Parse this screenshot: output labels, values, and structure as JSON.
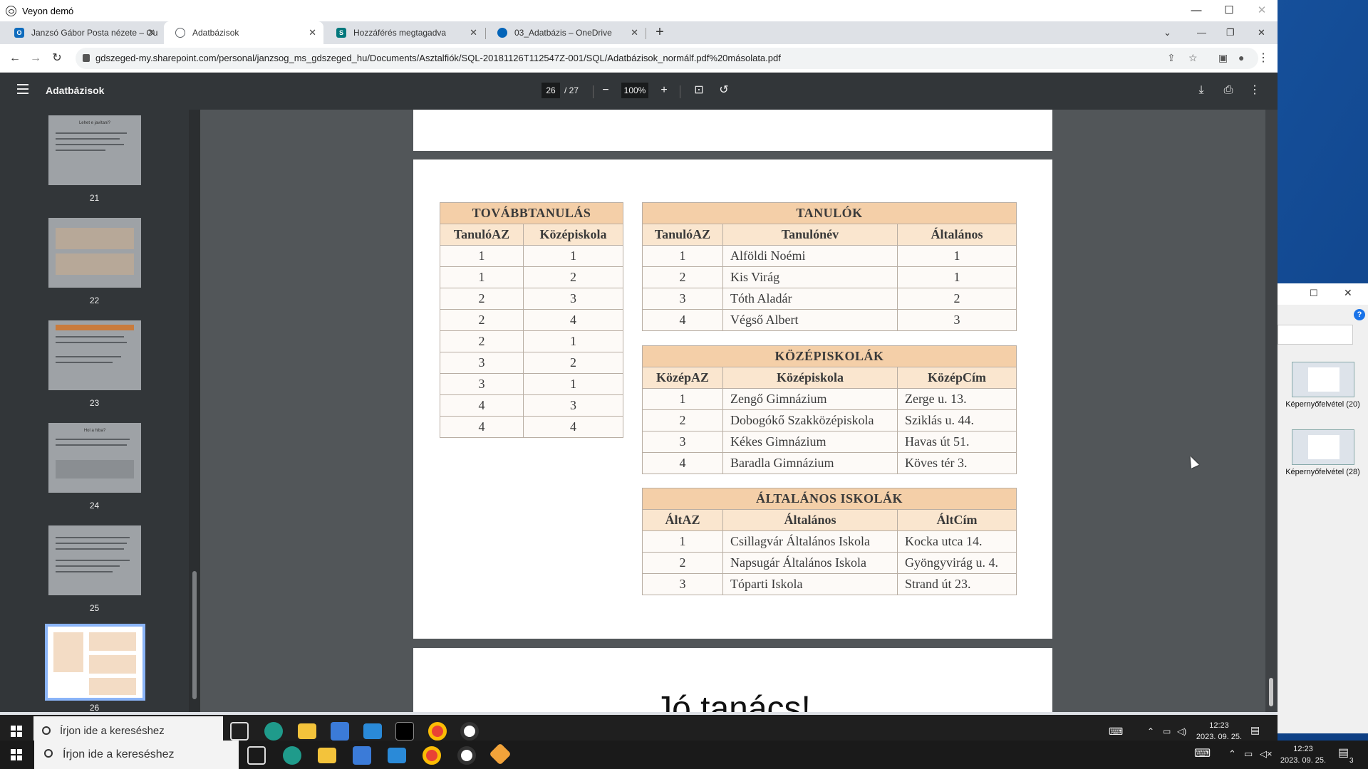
{
  "window": {
    "title": "Veyon demó"
  },
  "tabs": [
    {
      "label": "Janzsó Gábor Posta nézete – Ou",
      "icon": "outlook-icon",
      "color": "#0f6cbd",
      "glyph": "O"
    },
    {
      "label": "Adatbázisok",
      "icon": "globe-icon",
      "color": "#5f6368",
      "glyph": "◎"
    },
    {
      "label": "Hozzáférés megtagadva",
      "icon": "sharepoint-icon",
      "color": "#03787c",
      "glyph": "S"
    },
    {
      "label": "03_Adatbázis – OneDrive",
      "icon": "onedrive-icon",
      "color": "#0364b8",
      "glyph": "☁"
    }
  ],
  "url": "gdszeged-my.sharepoint.com/personal/janzsog_ms_gdszeged_hu/Documents/Asztalfiók/SQL-20181126T112547Z-001/SQL/Adatbázisok_normálf.pdf%20másolata.pdf",
  "pdf": {
    "title": "Adatbázisok",
    "page": "26",
    "page_total": "/ 27",
    "zoom": "100%"
  },
  "thumbnails": [
    "21",
    "22",
    "23",
    "24",
    "25",
    "26"
  ],
  "thumb_titles": {
    "t21": "Lehet e javítani?",
    "t24": "Hol a hiba?"
  },
  "tovabb": {
    "caption": "TOVÁBBTANULÁS",
    "headers": [
      "TanulóAZ",
      "Középiskola"
    ],
    "rows": [
      [
        "1",
        "1"
      ],
      [
        "1",
        "2"
      ],
      [
        "2",
        "3"
      ],
      [
        "2",
        "4"
      ],
      [
        "2",
        "1"
      ],
      [
        "3",
        "2"
      ],
      [
        "3",
        "1"
      ],
      [
        "4",
        "3"
      ],
      [
        "4",
        "4"
      ]
    ]
  },
  "tanulok": {
    "caption": "TANULÓK",
    "headers": [
      "TanulóAZ",
      "Tanulónév",
      "Általános"
    ],
    "rows": [
      [
        "1",
        "Alföldi Noémi",
        "1"
      ],
      [
        "2",
        "Kis Virág",
        "1"
      ],
      [
        "3",
        "Tóth Aladár",
        "2"
      ],
      [
        "4",
        "Végső Albert",
        "3"
      ]
    ]
  },
  "kozep": {
    "caption": "KÖZÉPISKOLÁK",
    "headers": [
      "KözépAZ",
      "Középiskola",
      "KözépCím"
    ],
    "rows": [
      [
        "1",
        "Zengő Gimnázium",
        "Zerge u. 13."
      ],
      [
        "2",
        "Dobogókő Szakközépiskola",
        "Sziklás u. 44."
      ],
      [
        "3",
        "Kékes Gimnázium",
        "Havas út 51."
      ],
      [
        "4",
        "Baradla Gimnázium",
        "Köves tér 3."
      ]
    ]
  },
  "altalanos": {
    "caption": "ÁLTALÁNOS ISKOLÁK",
    "headers": [
      "ÁltAZ",
      "Általános",
      "ÁltCím"
    ],
    "rows": [
      [
        "1",
        "Csillagvár Általános Iskola",
        "Kocka utca 14."
      ],
      [
        "2",
        "Napsugár Általános Iskola",
        "Gyöngyvirág u. 4."
      ],
      [
        "3",
        "Tóparti Iskola",
        "Strand út 23."
      ]
    ]
  },
  "next_page_title": "Jó tanács!",
  "taskbar": {
    "search_placeholder": "Írjon ide a kereséshez",
    "time": "12:23",
    "date": "2023. 09. 25.",
    "notif_count": "3"
  },
  "right_files": [
    "Képernyőfelvétel (20)",
    "Képernyőfelvétel (28)"
  ]
}
